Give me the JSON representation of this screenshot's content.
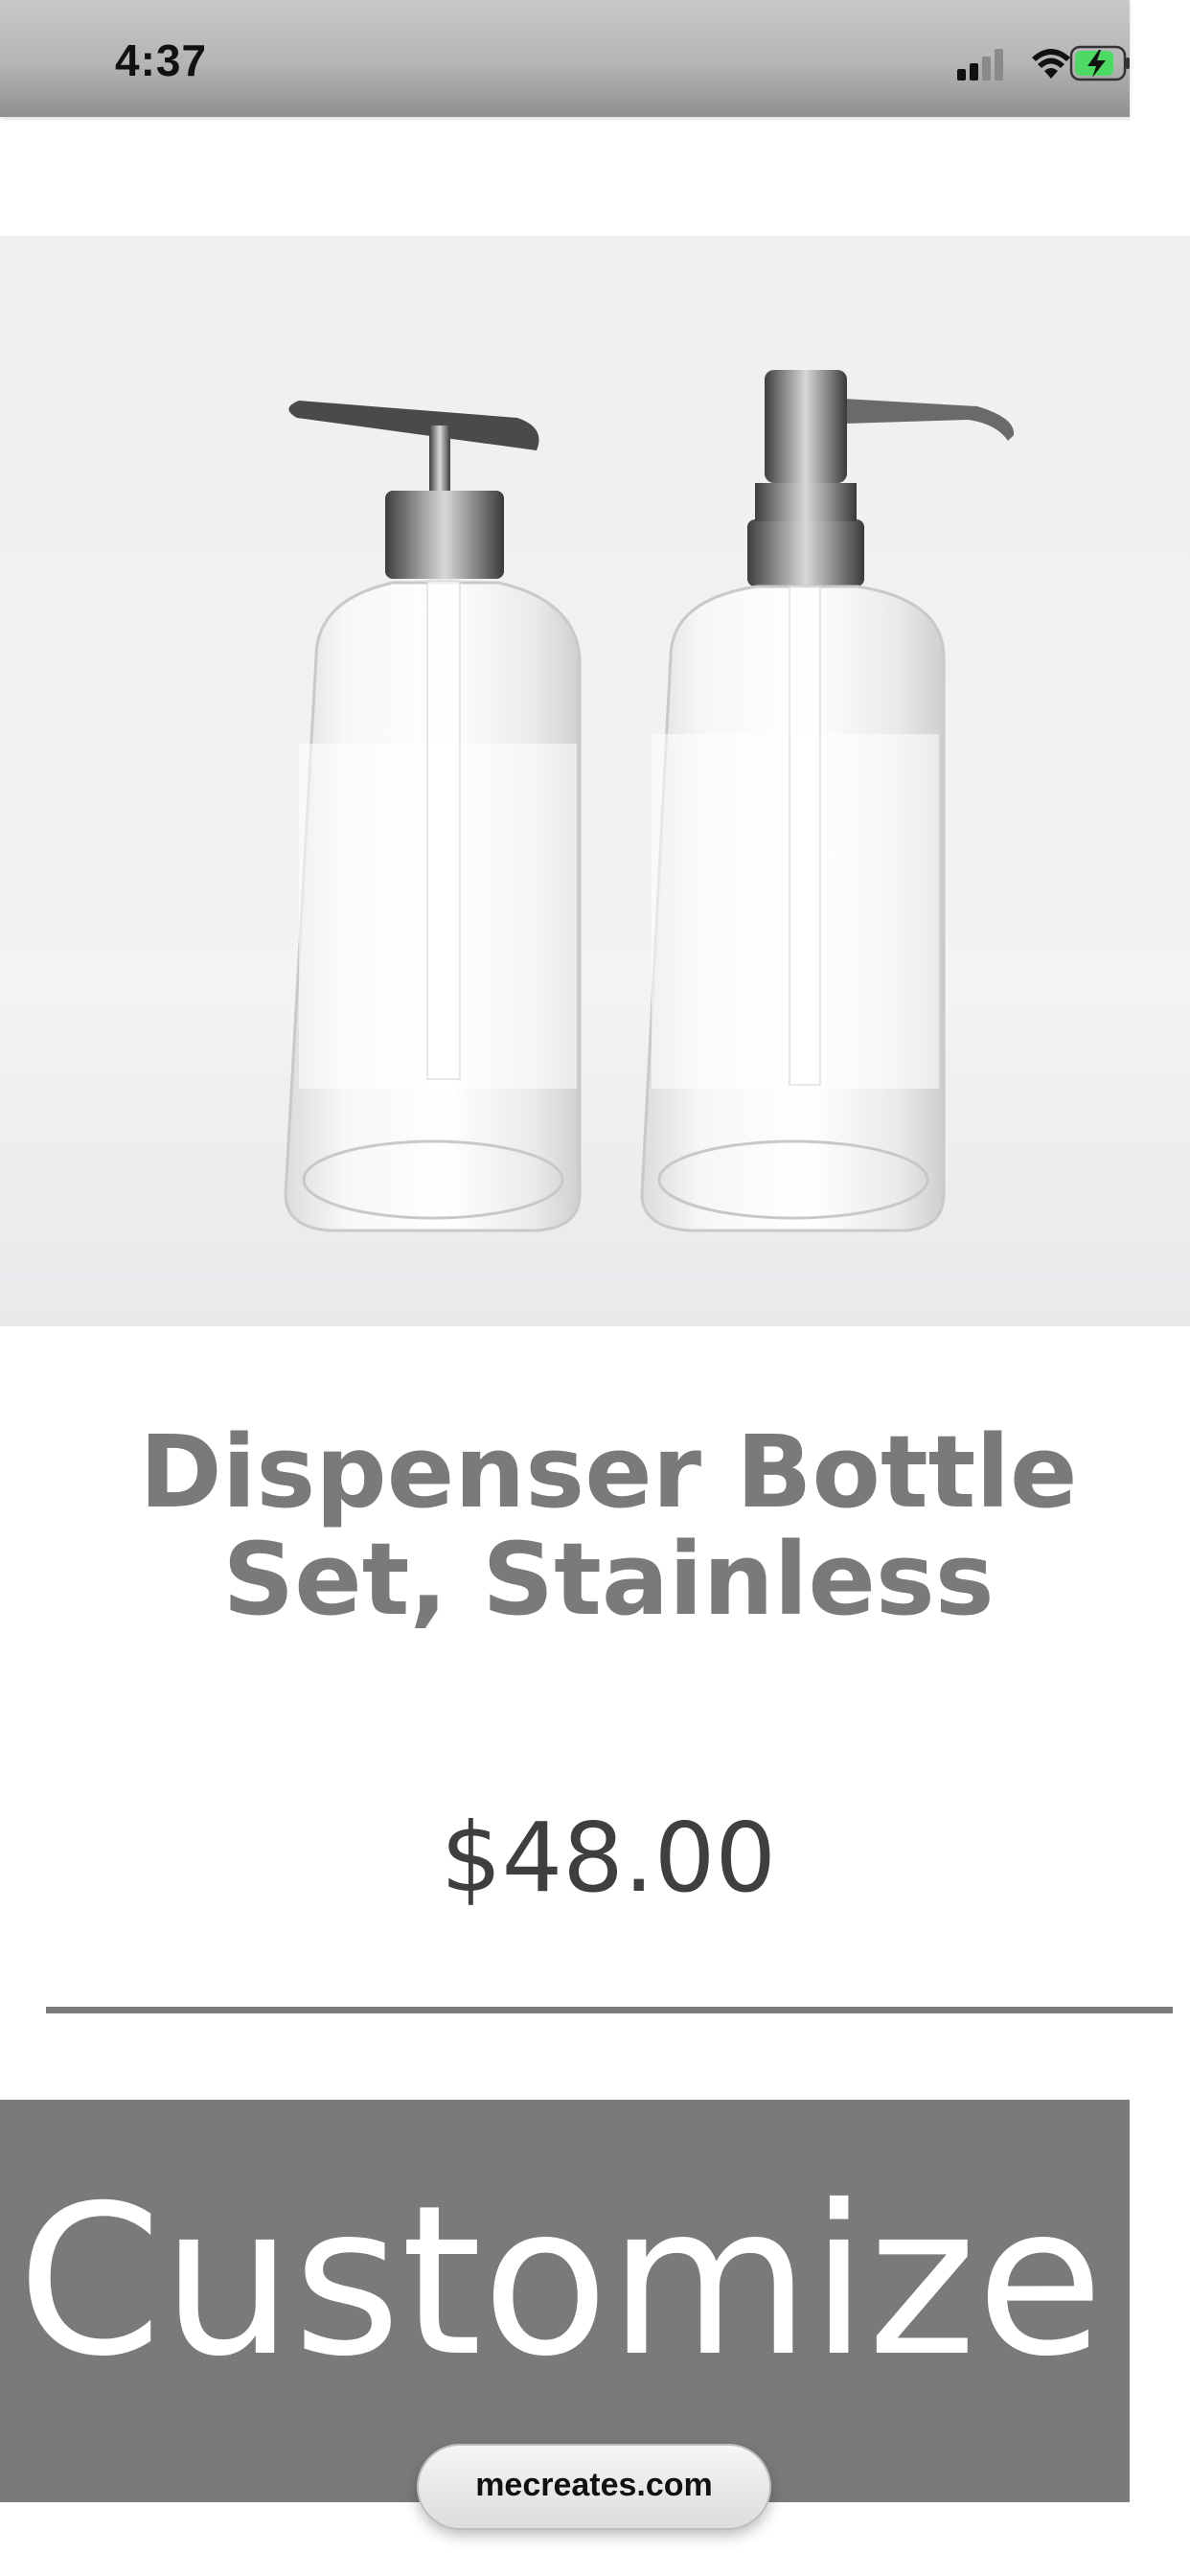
{
  "status_bar": {
    "time": "4:37",
    "icons": [
      "cellular-signal-icon",
      "wifi-icon",
      "battery-charging-icon"
    ],
    "battery_color": "#4cd964"
  },
  "product": {
    "image_name": "dispenser-bottles-image",
    "title": "Dispenser Bottle Set, Stainless",
    "price": "$48.00"
  },
  "actions": {
    "customize_label": "Customize"
  },
  "browser": {
    "url": "mecreates.com"
  },
  "colors": {
    "title_gray": "#7a7a7a",
    "price_text": "#3f3f3f",
    "button_bg": "#7a7a7a",
    "button_text": "#ffffff"
  }
}
